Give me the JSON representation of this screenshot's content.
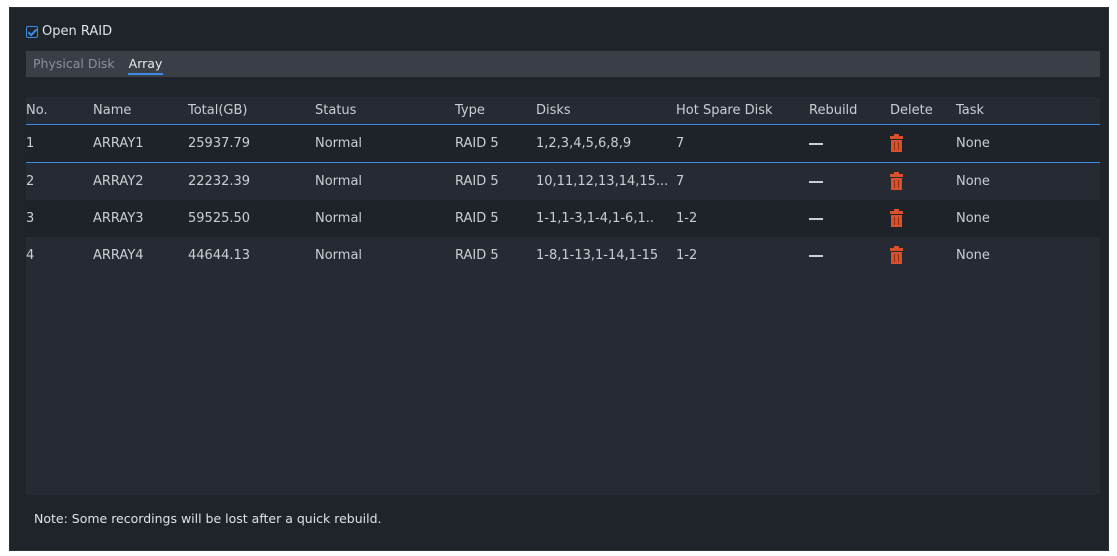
{
  "open_raid": {
    "label": "Open RAID",
    "checked": true
  },
  "tabs": [
    {
      "label": "Physical Disk",
      "active": false
    },
    {
      "label": "Array",
      "active": true
    }
  ],
  "table": {
    "columns": [
      "No.",
      "Name",
      "Total(GB)",
      "Status",
      "Type",
      "Disks",
      "Hot Spare Disk",
      "Rebuild",
      "Delete",
      "Task"
    ],
    "rows": [
      {
        "no": "1",
        "name": "ARRAY1",
        "total": "25937.79",
        "status": "Normal",
        "type": "RAID 5",
        "disks": "1,2,3,4,5,6,8,9",
        "hot_spare": "7",
        "rebuild_icon": "dash-icon",
        "delete_icon": "trash-icon",
        "task": "None"
      },
      {
        "no": "2",
        "name": "ARRAY2",
        "total": "22232.39",
        "status": "Normal",
        "type": "RAID 5",
        "disks": "10,11,12,13,14,15...",
        "hot_spare": "7",
        "rebuild_icon": "dash-icon",
        "delete_icon": "trash-icon",
        "task": "None"
      },
      {
        "no": "3",
        "name": "ARRAY3",
        "total": "59525.50",
        "status": "Normal",
        "type": "RAID 5",
        "disks": "1-1,1-3,1-4,1-6,1..",
        "hot_spare": "1-2",
        "rebuild_icon": "dash-icon",
        "delete_icon": "trash-icon",
        "task": "None"
      },
      {
        "no": "4",
        "name": "ARRAY4",
        "total": "44644.13",
        "status": "Normal",
        "type": "RAID 5",
        "disks": "1-8,1-13,1-14,1-15",
        "hot_spare": "1-2",
        "rebuild_icon": "dash-icon",
        "delete_icon": "trash-icon",
        "task": "None"
      }
    ]
  },
  "note": "Note: Some recordings will be lost after a quick rebuild.",
  "colors": {
    "background": "#1f232a",
    "accent": "#3a8be3",
    "delete": "#d9502b"
  }
}
